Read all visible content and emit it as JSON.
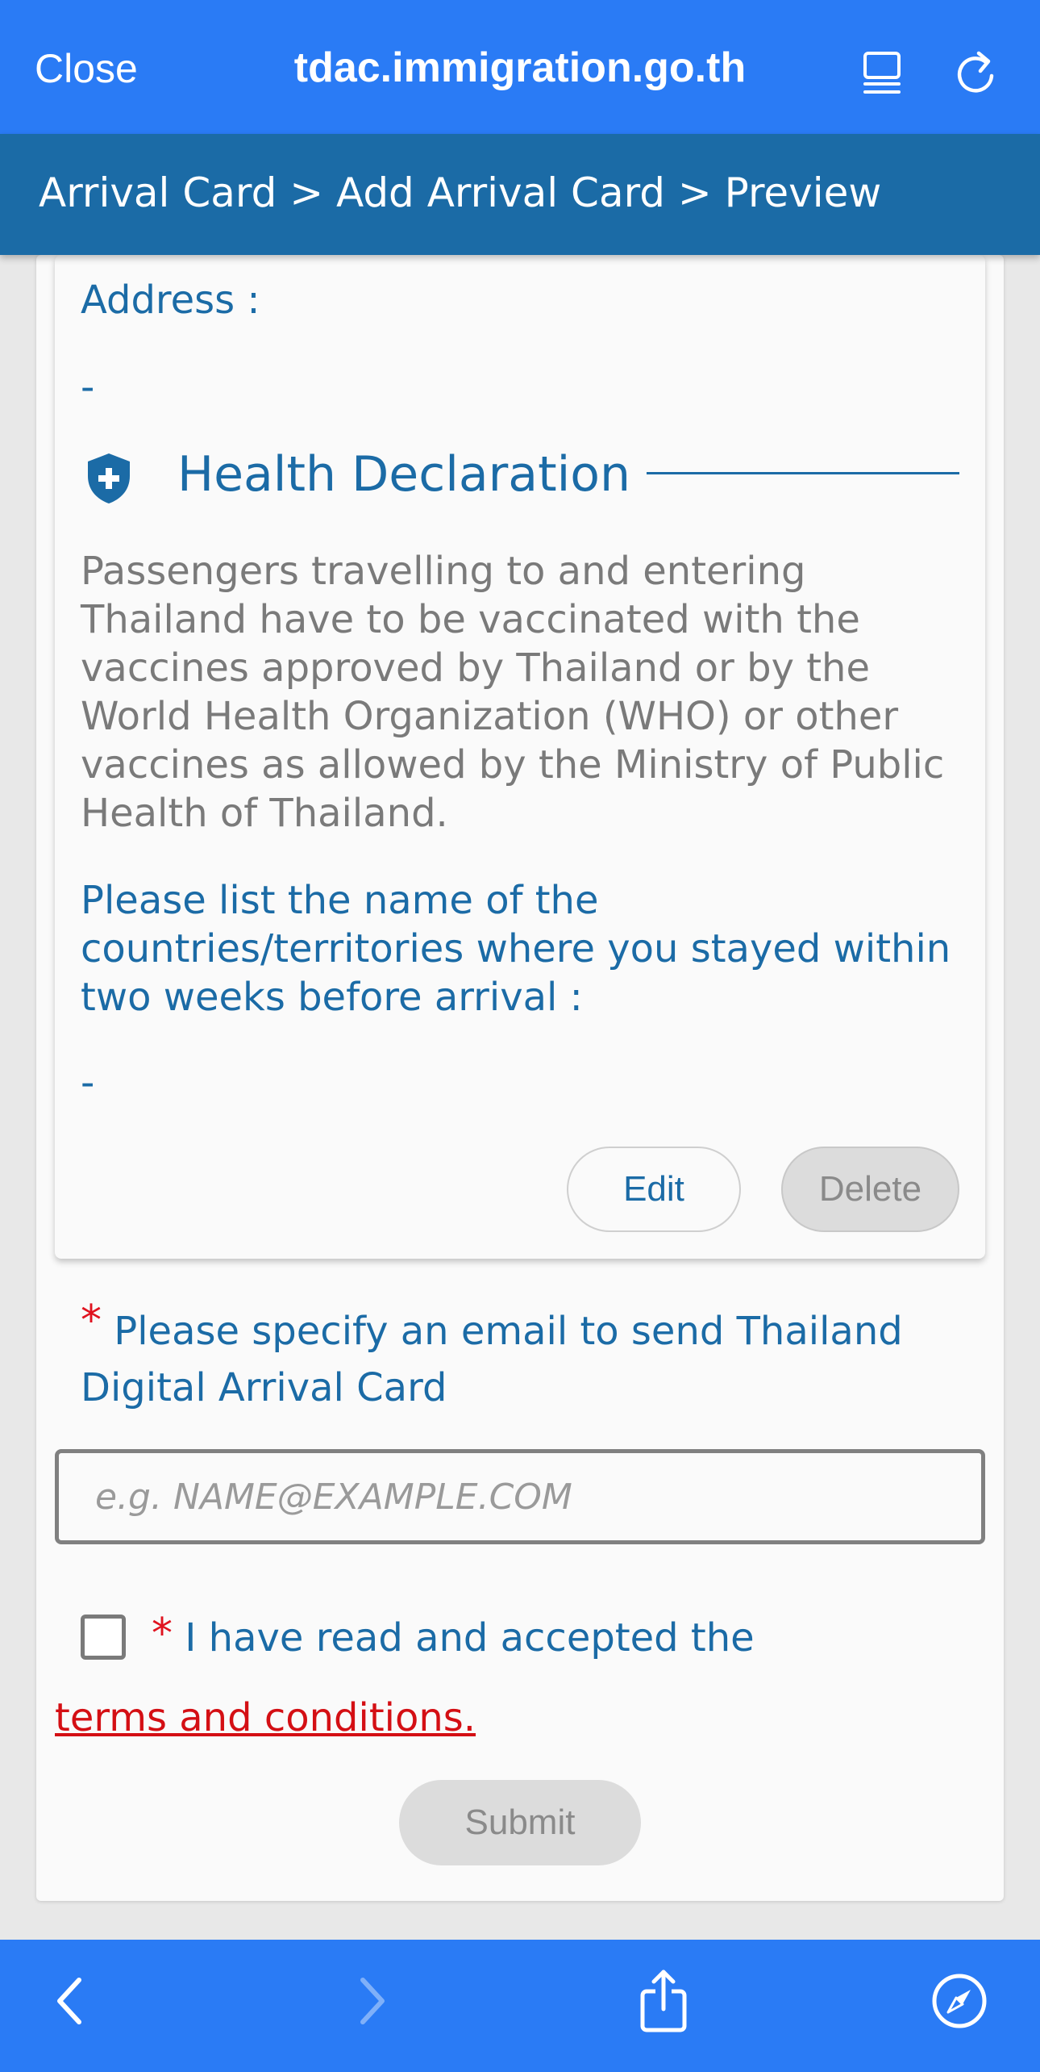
{
  "browser": {
    "close_label": "Close",
    "url": "tdac.immigration.go.th"
  },
  "breadcrumb": {
    "text": "Arrival Card > Add Arrival Card > Preview"
  },
  "address": {
    "label": "Address :",
    "value": "-"
  },
  "health": {
    "title": "Health Declaration",
    "description": "Passengers travelling to and entering Thailand have to be vaccinated with the vaccines approved by Thailand or by the World Health Organization (WHO) or other vaccines as allowed by the Ministry of Public Health of Thailand.",
    "countries_label": "Please list the name of the countries/territories where you stayed within two weeks before arrival :",
    "countries_value": "-"
  },
  "actions": {
    "edit_label": "Edit",
    "delete_label": "Delete"
  },
  "email": {
    "required_mark": "*",
    "label": "Please specify an email to send Thailand Digital Arrival Card",
    "placeholder": "e.g. NAME@EXAMPLE.COM"
  },
  "terms": {
    "required_mark": "*",
    "accept_label": "I have read and accepted the",
    "link_text": "terms and conditions.",
    "checked": false
  },
  "submit": {
    "label": "Submit"
  },
  "colors": {
    "browser_blue": "#2a7bf5",
    "header_blue": "#1b6ba6",
    "required_red": "#e0131f",
    "link_red": "#d40f14"
  },
  "icons": {
    "reader": "reader-mode-icon",
    "reload": "reload-icon",
    "section": "shield-plus-icon",
    "back": "chevron-left-icon",
    "forward": "chevron-right-icon",
    "share": "share-icon",
    "compass": "compass-icon"
  }
}
